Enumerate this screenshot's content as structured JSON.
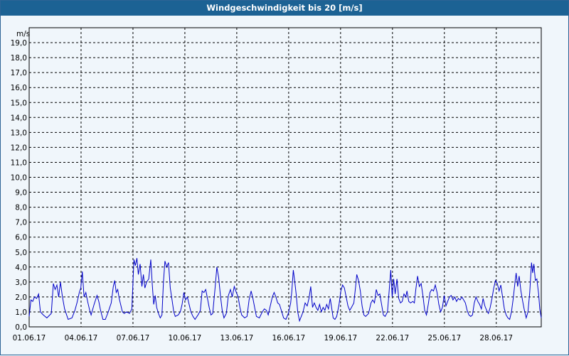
{
  "window": {
    "title": "Windgeschwindigkeit bis 20 [m/s]"
  },
  "colors": {
    "title_bar": "#1c6294",
    "series": "#0000c8",
    "grid": "#000000",
    "background": "#f0f6fb"
  },
  "chart_data": {
    "type": "line",
    "title": "Windgeschwindigkeit bis 20 [m/s]",
    "ylabel": "m/s",
    "xlabel": "",
    "ylim": [
      0,
      20
    ],
    "xlim": [
      "2017-06-01",
      "2017-06-30"
    ],
    "grid": true,
    "y_ticks": [
      "0,0",
      "1,0",
      "2,0",
      "3,0",
      "4,0",
      "5,0",
      "6,0",
      "7,0",
      "8,0",
      "9,0",
      "10,0",
      "11,0",
      "12,0",
      "13,0",
      "14,0",
      "15,0",
      "16,0",
      "17,0",
      "18,0",
      "19,0"
    ],
    "x_ticks": [
      "01.06.17",
      "04.06.17",
      "07.06.17",
      "10.06.17",
      "13.06.17",
      "16.06.17",
      "19.06.17",
      "22.06.17",
      "25.06.17",
      "28.06.17"
    ],
    "series": [
      {
        "values": [
          [
            1.0,
            0.7
          ],
          [
            1.06,
            1.8
          ],
          [
            1.12,
            1.7
          ],
          [
            1.18,
            2.0
          ],
          [
            1.25,
            1.9
          ],
          [
            1.32,
            2.2
          ],
          [
            1.38,
            1.0
          ],
          [
            1.48,
            0.8
          ],
          [
            1.6,
            0.6
          ],
          [
            1.75,
            0.9
          ],
          [
            1.82,
            2.9
          ],
          [
            1.88,
            2.5
          ],
          [
            1.94,
            2.8
          ],
          [
            2.0,
            2.0
          ],
          [
            2.06,
            3.0
          ],
          [
            2.12,
            2.1
          ],
          [
            2.2,
            1.2
          ],
          [
            2.32,
            0.5
          ],
          [
            2.45,
            0.6
          ],
          [
            2.55,
            1.1
          ],
          [
            2.62,
            1.6
          ],
          [
            2.7,
            2.3
          ],
          [
            2.75,
            2.6
          ],
          [
            2.8,
            3.7
          ],
          [
            2.86,
            2.0
          ],
          [
            2.92,
            2.3
          ],
          [
            2.98,
            1.7
          ],
          [
            3.05,
            1.1
          ],
          [
            3.1,
            0.8
          ],
          [
            3.2,
            1.5
          ],
          [
            3.3,
            2.1
          ],
          [
            3.36,
            1.7
          ],
          [
            3.42,
            1.1
          ],
          [
            3.5,
            0.5
          ],
          [
            3.58,
            0.5
          ],
          [
            3.68,
            1.0
          ],
          [
            3.78,
            1.6
          ],
          [
            3.85,
            2.7
          ],
          [
            3.9,
            3.1
          ],
          [
            3.95,
            2.3
          ],
          [
            4.0,
            2.5
          ],
          [
            4.05,
            1.9
          ],
          [
            4.1,
            1.5
          ],
          [
            4.16,
            1.0
          ],
          [
            4.22,
            0.9
          ],
          [
            4.3,
            1.0
          ],
          [
            4.4,
            0.9
          ],
          [
            4.48,
            1.2
          ],
          [
            4.55,
            4.5
          ],
          [
            4.6,
            4.1
          ],
          [
            4.65,
            4.6
          ],
          [
            4.7,
            3.5
          ],
          [
            4.76,
            4.2
          ],
          [
            4.82,
            2.7
          ],
          [
            4.87,
            3.5
          ],
          [
            4.92,
            2.6
          ],
          [
            4.98,
            3.0
          ],
          [
            5.05,
            3.2
          ],
          [
            5.12,
            4.5
          ],
          [
            5.17,
            2.9
          ],
          [
            5.22,
            1.5
          ],
          [
            5.27,
            2.1
          ],
          [
            5.32,
            1.3
          ],
          [
            5.38,
            0.9
          ],
          [
            5.44,
            0.6
          ],
          [
            5.5,
            0.8
          ],
          [
            5.55,
            3.0
          ],
          [
            5.6,
            4.4
          ],
          [
            5.66,
            4.0
          ],
          [
            5.72,
            4.3
          ],
          [
            5.78,
            2.6
          ],
          [
            5.84,
            1.8
          ],
          [
            5.9,
            1.0
          ],
          [
            5.95,
            0.7
          ],
          [
            6.05,
            0.8
          ],
          [
            6.12,
            1.0
          ],
          [
            6.18,
            1.5
          ],
          [
            6.24,
            2.3
          ],
          [
            6.3,
            1.8
          ],
          [
            6.36,
            2.0
          ],
          [
            6.42,
            1.5
          ],
          [
            6.48,
            1.0
          ],
          [
            6.55,
            0.7
          ],
          [
            6.62,
            0.5
          ],
          [
            6.72,
            0.8
          ],
          [
            6.8,
            1.1
          ],
          [
            6.86,
            2.4
          ],
          [
            6.92,
            2.3
          ],
          [
            6.98,
            2.5
          ],
          [
            7.05,
            1.8
          ],
          [
            7.1,
            1.3
          ],
          [
            7.16,
            0.8
          ],
          [
            7.22,
            0.9
          ],
          [
            7.3,
            2.6
          ],
          [
            7.36,
            4.0
          ],
          [
            7.42,
            3.3
          ],
          [
            7.48,
            2.1
          ],
          [
            7.54,
            1.1
          ],
          [
            7.6,
            0.6
          ],
          [
            7.68,
            0.9
          ],
          [
            7.75,
            2.1
          ],
          [
            7.82,
            2.5
          ],
          [
            7.88,
            2.0
          ],
          [
            7.95,
            2.7
          ],
          [
            8.02,
            2.3
          ],
          [
            8.08,
            2.0
          ],
          [
            8.14,
            1.3
          ],
          [
            8.2,
            0.8
          ],
          [
            8.3,
            0.6
          ],
          [
            8.38,
            0.7
          ],
          [
            8.45,
            1.8
          ],
          [
            8.52,
            2.4
          ],
          [
            8.58,
            1.9
          ],
          [
            8.64,
            1.3
          ],
          [
            8.7,
            0.7
          ],
          [
            8.8,
            0.6
          ],
          [
            8.9,
            1.0
          ],
          [
            8.97,
            1.2
          ],
          [
            9.04,
            1.1
          ],
          [
            9.1,
            0.8
          ],
          [
            9.18,
            1.5
          ],
          [
            9.24,
            2.0
          ],
          [
            9.3,
            2.3
          ],
          [
            9.36,
            2.0
          ],
          [
            9.42,
            1.6
          ],
          [
            9.48,
            1.5
          ],
          [
            9.56,
            1.0
          ],
          [
            9.62,
            0.6
          ],
          [
            9.7,
            0.5
          ],
          [
            9.78,
            0.9
          ],
          [
            9.86,
            1.6
          ],
          [
            9.9,
            2.4
          ],
          [
            9.95,
            3.8
          ],
          [
            10.0,
            3.0
          ],
          [
            10.05,
            2.1
          ],
          [
            10.1,
            1.0
          ],
          [
            10.16,
            0.4
          ],
          [
            10.22,
            0.7
          ],
          [
            10.28,
            1.0
          ],
          [
            10.35,
            1.6
          ],
          [
            10.42,
            1.4
          ],
          [
            10.48,
            1.9
          ],
          [
            10.54,
            2.7
          ],
          [
            10.6,
            1.3
          ],
          [
            10.66,
            1.6
          ],
          [
            10.72,
            1.3
          ],
          [
            10.78,
            1.1
          ],
          [
            10.84,
            1.5
          ],
          [
            10.9,
            1.0
          ],
          [
            10.96,
            1.3
          ],
          [
            11.02,
            1.1
          ],
          [
            11.08,
            1.5
          ],
          [
            11.14,
            1.2
          ],
          [
            11.2,
            1.9
          ],
          [
            11.24,
            1.4
          ],
          [
            11.3,
            0.6
          ],
          [
            11.36,
            0.5
          ],
          [
            11.42,
            0.7
          ],
          [
            11.5,
            1.5
          ],
          [
            11.56,
            2.4
          ],
          [
            11.62,
            2.8
          ],
          [
            11.68,
            2.6
          ],
          [
            11.74,
            2.0
          ],
          [
            11.8,
            1.4
          ],
          [
            11.86,
            1.1
          ],
          [
            11.92,
            1.3
          ],
          [
            12.0,
            1.6
          ],
          [
            12.06,
            2.7
          ],
          [
            12.1,
            3.5
          ],
          [
            12.16,
            3.1
          ],
          [
            12.22,
            2.4
          ],
          [
            12.28,
            1.4
          ],
          [
            12.34,
            0.8
          ],
          [
            12.4,
            0.7
          ],
          [
            12.5,
            0.9
          ],
          [
            12.58,
            1.6
          ],
          [
            12.64,
            1.8
          ],
          [
            12.7,
            1.6
          ],
          [
            12.76,
            2.5
          ],
          [
            12.82,
            2.1
          ],
          [
            12.88,
            2.2
          ],
          [
            12.94,
            1.5
          ],
          [
            13.0,
            0.8
          ],
          [
            13.06,
            0.7
          ],
          [
            13.14,
            1.0
          ],
          [
            13.2,
            2.5
          ],
          [
            13.25,
            3.8
          ],
          [
            13.3,
            2.0
          ],
          [
            13.35,
            3.2
          ],
          [
            13.4,
            2.2
          ],
          [
            13.46,
            3.2
          ],
          [
            13.52,
            1.9
          ],
          [
            13.58,
            1.6
          ],
          [
            13.64,
            1.7
          ],
          [
            13.7,
            2.2
          ],
          [
            13.76,
            2.0
          ],
          [
            13.8,
            2.4
          ],
          [
            13.86,
            1.7
          ],
          [
            13.92,
            1.6
          ],
          [
            14.0,
            1.7
          ],
          [
            14.05,
            1.6
          ],
          [
            14.1,
            2.5
          ],
          [
            14.16,
            3.4
          ],
          [
            14.22,
            2.7
          ],
          [
            14.28,
            2.9
          ],
          [
            14.34,
            2.1
          ],
          [
            14.4,
            1.1
          ],
          [
            14.46,
            0.8
          ],
          [
            14.52,
            1.5
          ],
          [
            14.58,
            2.3
          ],
          [
            14.64,
            2.5
          ],
          [
            14.7,
            2.4
          ],
          [
            14.76,
            2.8
          ],
          [
            14.82,
            2.3
          ],
          [
            14.88,
            1.5
          ],
          [
            14.94,
            1.0
          ],
          [
            15.0,
            1.3
          ],
          [
            15.06,
            2.1
          ],
          [
            15.12,
            1.4
          ],
          [
            15.18,
            1.7
          ],
          [
            15.24,
            2.0
          ],
          [
            15.3,
            2.1
          ],
          [
            15.36,
            1.8
          ],
          [
            15.42,
            2.0
          ],
          [
            15.48,
            1.7
          ],
          [
            15.54,
            1.9
          ],
          [
            15.6,
            1.8
          ],
          [
            15.66,
            2.0
          ],
          [
            15.72,
            1.8
          ],
          [
            15.78,
            1.6
          ],
          [
            15.84,
            1.1
          ],
          [
            15.9,
            0.8
          ],
          [
            15.96,
            0.7
          ],
          [
            16.02,
            0.8
          ],
          [
            16.08,
            1.6
          ],
          [
            16.14,
            2.0
          ],
          [
            16.2,
            1.7
          ],
          [
            16.26,
            1.5
          ],
          [
            16.32,
            1.2
          ],
          [
            16.38,
            1.9
          ],
          [
            16.44,
            1.4
          ],
          [
            16.5,
            1.1
          ],
          [
            16.56,
            0.9
          ],
          [
            16.62,
            1.3
          ],
          [
            16.68,
            1.9
          ],
          [
            16.74,
            2.6
          ],
          [
            16.8,
            3.1
          ],
          [
            16.86,
            2.9
          ],
          [
            16.92,
            2.4
          ],
          [
            16.98,
            2.8
          ],
          [
            17.04,
            2.0
          ],
          [
            17.1,
            1.2
          ],
          [
            17.16,
            0.8
          ],
          [
            17.22,
            0.6
          ],
          [
            17.28,
            0.5
          ],
          [
            17.34,
            1.0
          ],
          [
            17.4,
            1.9
          ],
          [
            17.46,
            3.0
          ],
          [
            17.5,
            3.6
          ],
          [
            17.55,
            2.7
          ],
          [
            17.6,
            3.4
          ],
          [
            17.66,
            2.4
          ],
          [
            17.72,
            1.7
          ],
          [
            17.78,
            1.1
          ],
          [
            17.84,
            0.6
          ],
          [
            17.9,
            1.0
          ],
          [
            17.96,
            2.3
          ],
          [
            18.02,
            4.3
          ],
          [
            18.06,
            3.6
          ],
          [
            18.1,
            4.2
          ],
          [
            18.15,
            3.1
          ],
          [
            18.2,
            3.2
          ],
          [
            18.26,
            2.2
          ],
          [
            18.3,
            1.2
          ],
          [
            18.35,
            0.6
          ]
        ]
      }
    ]
  }
}
